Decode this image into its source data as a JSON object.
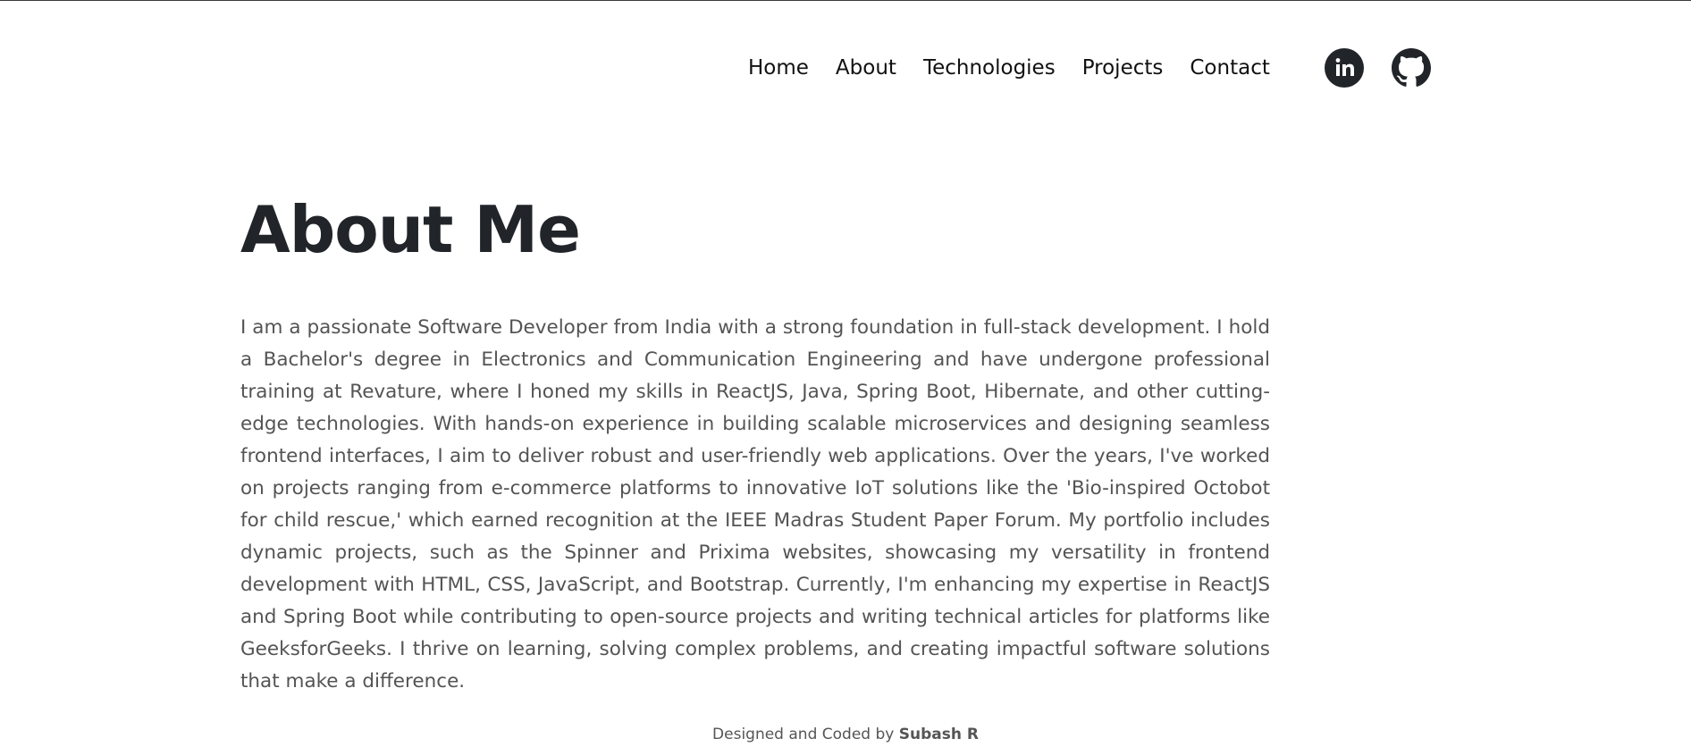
{
  "nav": {
    "items": [
      {
        "label": "Home"
      },
      {
        "label": "About"
      },
      {
        "label": "Technologies"
      },
      {
        "label": "Projects"
      },
      {
        "label": "Contact"
      }
    ],
    "socials": [
      {
        "icon": "linkedin-icon"
      },
      {
        "icon": "github-icon"
      }
    ]
  },
  "about": {
    "title": "About Me",
    "text": "I am a passionate Software Developer from India with a strong foundation in full-stack development. I hold a Bachelor's degree in Electronics and Communication Engineering and have undergone professional training at Revature, where I honed my skills in ReactJS, Java, Spring Boot, Hibernate, and other cutting-edge technologies. With hands-on experience in building scalable microservices and designing seamless frontend interfaces, I aim to deliver robust and user-friendly web applications. Over the years, I've worked on projects ranging from e-commerce platforms to innovative IoT solutions like the 'Bio-inspired Octobot for child rescue,' which earned recognition at the IEEE Madras Student Paper Forum. My portfolio includes dynamic projects, such as the Spinner and Prixima websites, showcasing my versatility in frontend development with HTML, CSS, JavaScript, and Bootstrap. Currently, I'm enhancing my expertise in ReactJS and Spring Boot while contributing to open-source projects and writing technical articles for platforms like GeeksforGeeks. I thrive on learning, solving complex problems, and creating impactful software solutions that make a difference."
  },
  "footer": {
    "prefix": "Designed and Coded by ",
    "author": "Subash R"
  },
  "colors": {
    "text_dark": "#212529",
    "text_body": "#545454",
    "icon_bg": "#212529"
  }
}
